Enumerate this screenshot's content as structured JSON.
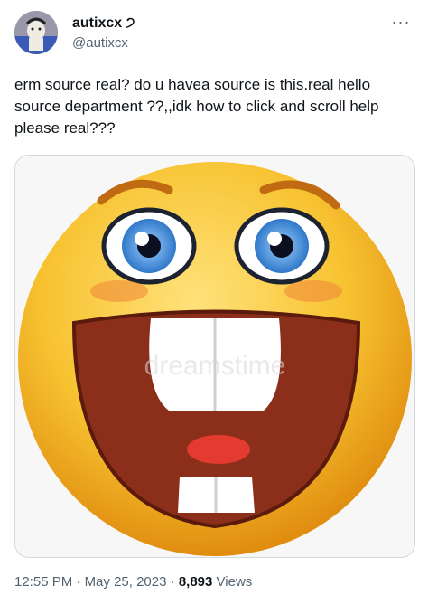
{
  "user": {
    "display_name": "autixcx",
    "badge_glyph": "੭",
    "handle": "@autixcx"
  },
  "menu": {
    "more_glyph": "···"
  },
  "tweet": {
    "text": "erm source real? do u havea  source is this.real hello source department ??,,idk how to click and scroll help please real???"
  },
  "media": {
    "watermark": "dreamstime",
    "description_icon": "smiley-face-emoji"
  },
  "meta": {
    "time": "12:55 PM",
    "date": "May 25, 2023",
    "views_count": "8,893",
    "views_label": "Views",
    "separator": " · "
  },
  "colors": {
    "text": "#0f1419",
    "secondary": "#536471",
    "face": "#f5b82a",
    "mouth": "#8b2f1a"
  }
}
